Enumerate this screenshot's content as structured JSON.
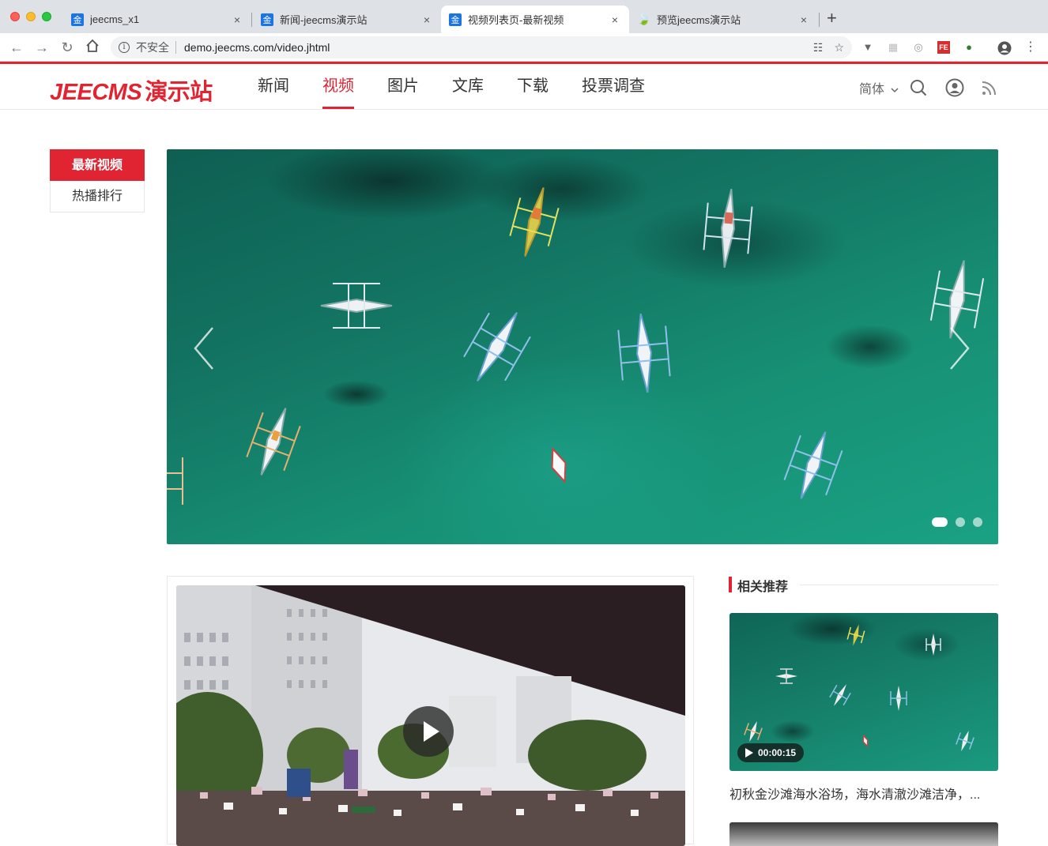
{
  "browser": {
    "tabs": [
      {
        "favicon": "金",
        "title": "jeecms_x1",
        "active": false
      },
      {
        "favicon": "金",
        "title": "新闻-jeecms演示站",
        "active": false
      },
      {
        "favicon": "金",
        "title": "视频列表页-最新视频",
        "active": true
      },
      {
        "favicon": "leaf",
        "title": "预览jeecms演示站",
        "active": false
      }
    ],
    "close_glyph": "×",
    "new_tab_glyph": "+",
    "address": {
      "security_label": "不安全",
      "url": "demo.jeecms.com/video.jhtml"
    },
    "icons": [
      "back-icon",
      "forward-icon",
      "reload-icon",
      "home-icon",
      "info-icon",
      "translate-icon",
      "star-icon",
      "profile-icon",
      "menu-icon"
    ]
  },
  "site": {
    "logo_latin": "JEECMS",
    "logo_cn": "演示站",
    "nav": [
      {
        "label": "新闻",
        "active": false
      },
      {
        "label": "视频",
        "active": true
      },
      {
        "label": "图片",
        "active": false
      },
      {
        "label": "文库",
        "active": false
      },
      {
        "label": "下载",
        "active": false
      },
      {
        "label": "投票调查",
        "active": false
      }
    ],
    "language": "简体",
    "accent_color": "#e02432"
  },
  "sidebar": {
    "items": [
      {
        "label": "最新视频",
        "active": true
      },
      {
        "label": "热播排行",
        "active": false
      }
    ]
  },
  "banner": {
    "slide_count": 3,
    "active_slide": 1
  },
  "related": {
    "heading": "相关推荐",
    "items": [
      {
        "duration": "00:00:15",
        "title": "初秋金沙滩海水浴场，海水清澈沙滩洁净，..."
      }
    ]
  }
}
